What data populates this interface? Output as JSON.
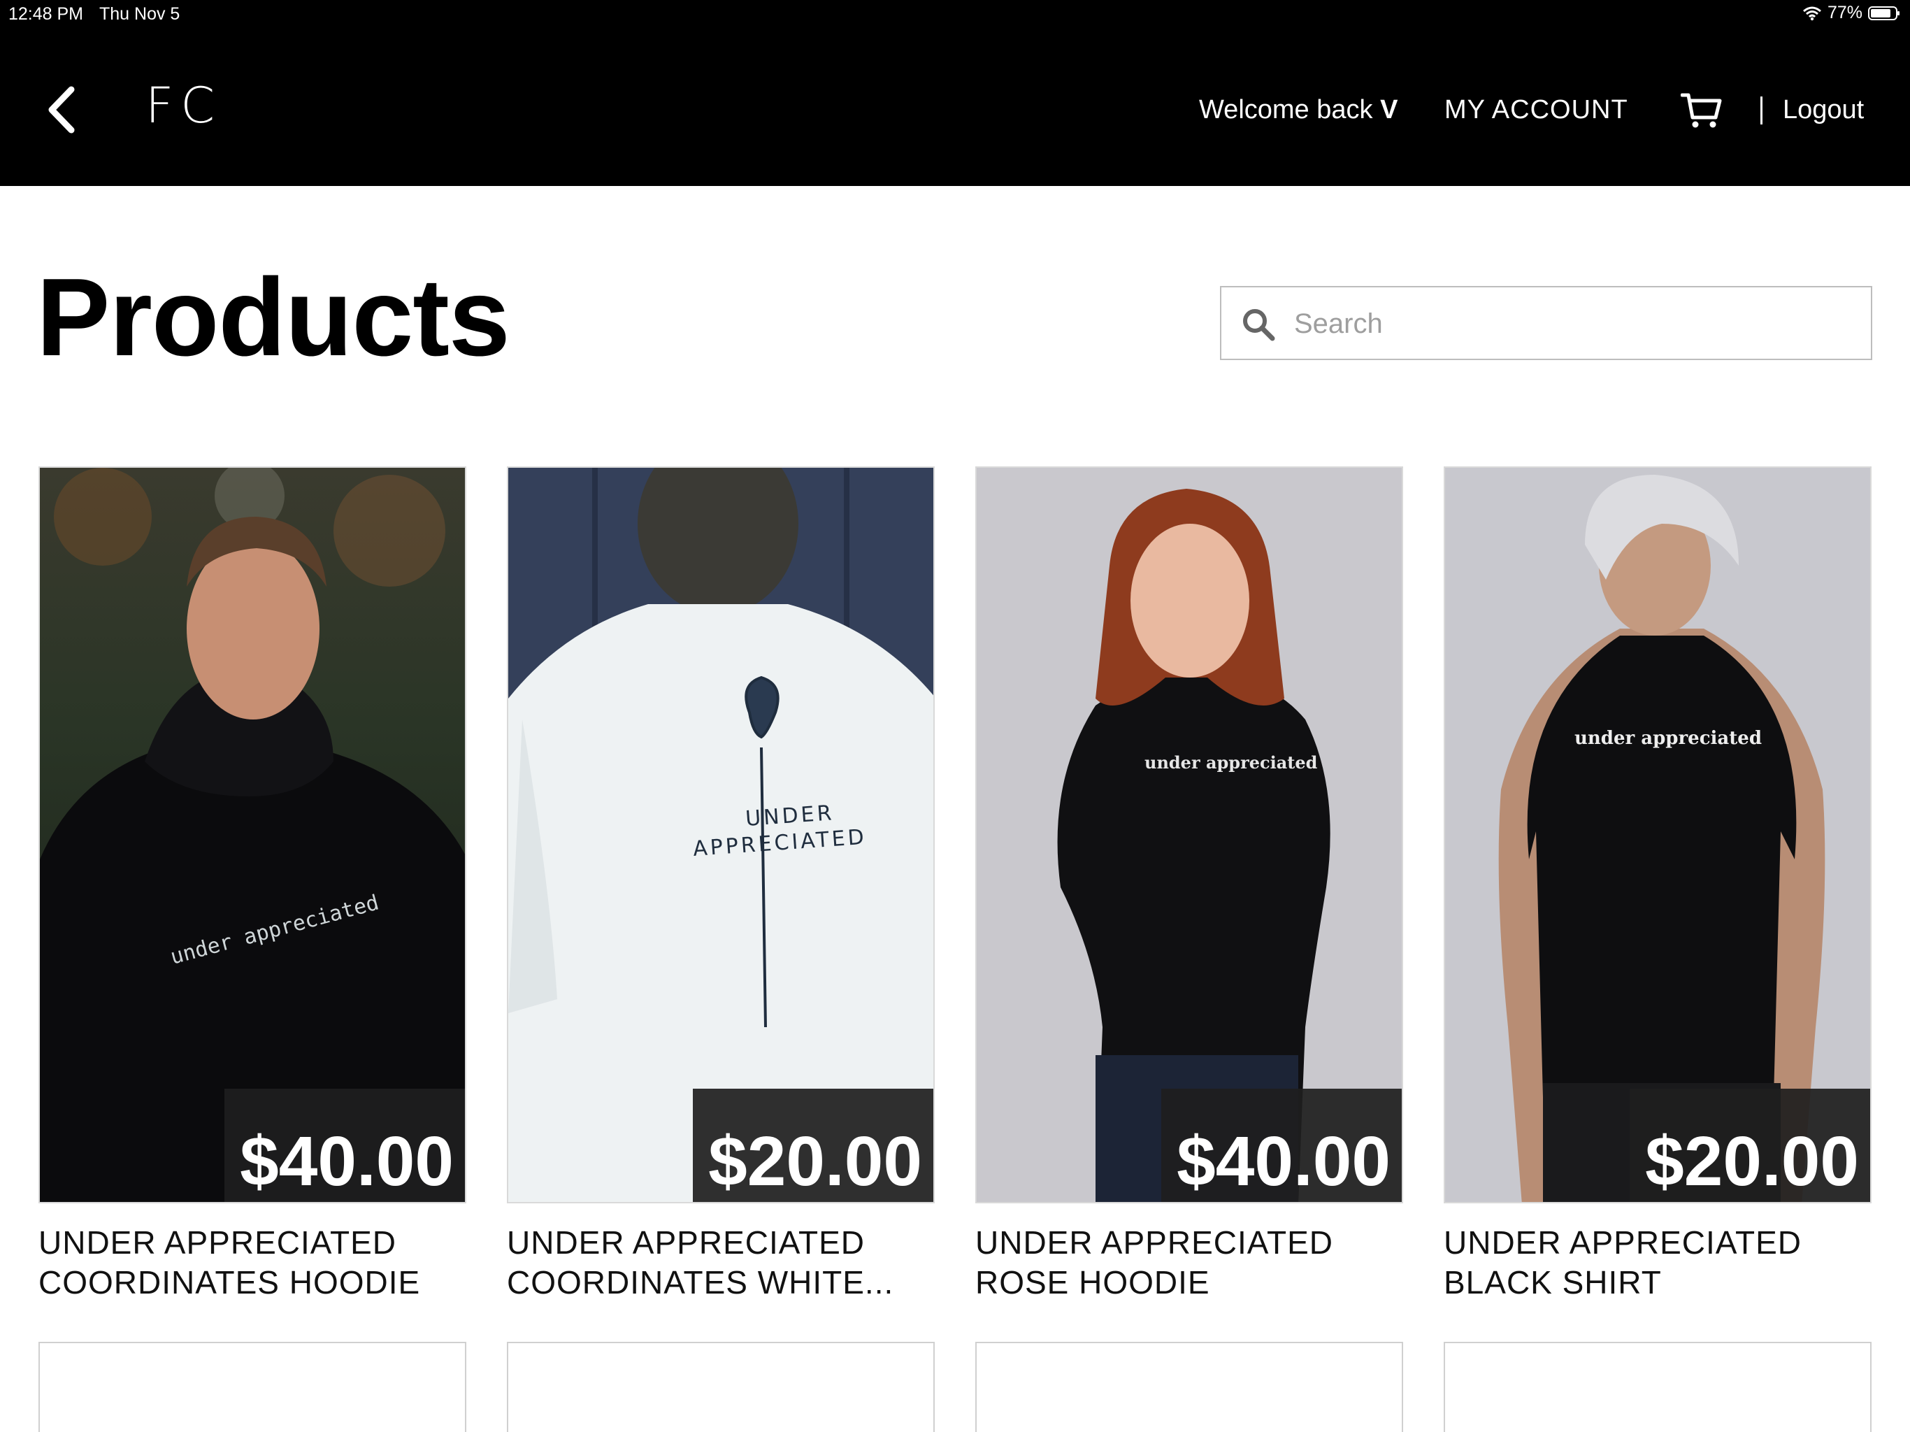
{
  "status_bar": {
    "time": "12:48 PM",
    "date": "Thu Nov 5",
    "battery": "77%"
  },
  "nav": {
    "brand": "FC",
    "welcome_text": "Welcome back",
    "user_initial": "V",
    "account_label": "MY ACCOUNT",
    "logout_label": "Logout"
  },
  "page": {
    "title": "Products"
  },
  "search": {
    "placeholder": "Search",
    "value": ""
  },
  "products": [
    {
      "name_line1": "UNDER APPRECIATED",
      "name_line2": "COORDINATES HOODIE",
      "price": "$40.00"
    },
    {
      "name_line1": "UNDER APPRECIATED",
      "name_line2": "COORDINATES WHITE...",
      "price": "$20.00"
    },
    {
      "name_line1": "UNDER APPRECIATED",
      "name_line2": "ROSE HOODIE",
      "price": "$40.00"
    },
    {
      "name_line1": "UNDER APPRECIATED",
      "name_line2": "BLACK SHIRT",
      "price": "$20.00"
    }
  ],
  "icons": {
    "back": "chevron-left-icon",
    "cart": "cart-icon",
    "search": "search-icon",
    "wifi": "wifi-icon",
    "battery": "battery-icon"
  },
  "colors": {
    "header_bg": "#000000",
    "price_tag_bg": "#1e1e1e",
    "text": "#111111"
  }
}
